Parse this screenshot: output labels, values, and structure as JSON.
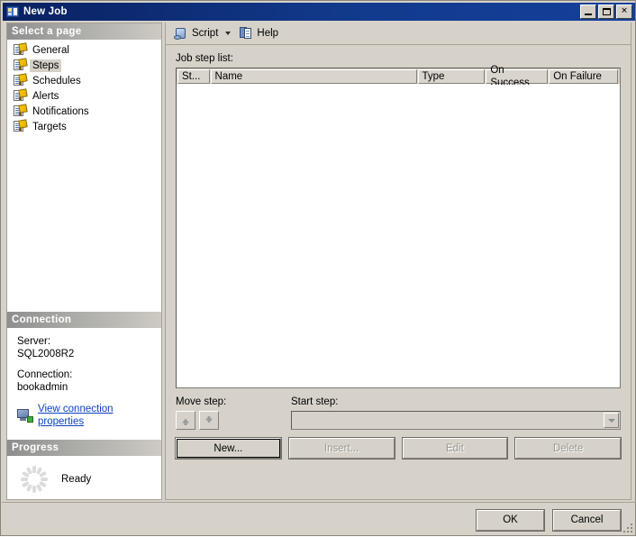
{
  "window": {
    "title": "New Job",
    "icon": "job-window-icon",
    "controls": {
      "minimize": "minimize-button",
      "maximize": "maximize-button",
      "close": "✕"
    }
  },
  "sidebar": {
    "header": "Select a page",
    "items": [
      {
        "label": "General",
        "selected": false
      },
      {
        "label": "Steps",
        "selected": true
      },
      {
        "label": "Schedules",
        "selected": false
      },
      {
        "label": "Alerts",
        "selected": false
      },
      {
        "label": "Notifications",
        "selected": false
      },
      {
        "label": "Targets",
        "selected": false
      }
    ],
    "connection": {
      "header": "Connection",
      "server_label": "Server:",
      "server_value": "SQL2008R2",
      "connection_label": "Connection:",
      "connection_value": "bookadmin",
      "link": "View connection properties"
    },
    "progress": {
      "header": "Progress",
      "status": "Ready"
    }
  },
  "toolbar": {
    "script_label": "Script",
    "script_icon": "script-icon",
    "dropdown_icon": "chevron-down-icon",
    "help_label": "Help",
    "help_icon": "help-icon"
  },
  "main": {
    "list_label": "Job step list:",
    "columns": [
      "St...",
      "Name",
      "Type",
      "On Success",
      "On Failure"
    ],
    "rows": [],
    "move_step_label": "Move step:",
    "move_up_icon": "arrow-up-icon",
    "move_down_icon": "arrow-down-icon",
    "start_step_label": "Start step:",
    "start_step_value": "",
    "buttons": [
      {
        "label": "New...",
        "disabled": false,
        "focused": true
      },
      {
        "label": "Insert...",
        "disabled": true,
        "focused": false
      },
      {
        "label": "Edit",
        "disabled": true,
        "focused": false
      },
      {
        "label": "Delete",
        "disabled": true,
        "focused": false
      }
    ]
  },
  "footer": {
    "ok": "OK",
    "cancel": "Cancel"
  },
  "colors": {
    "titlebar": "#0a2161",
    "dialog_face": "#d6d2ca",
    "link": "#0b3fc4",
    "selection": "#d4d0c8"
  }
}
